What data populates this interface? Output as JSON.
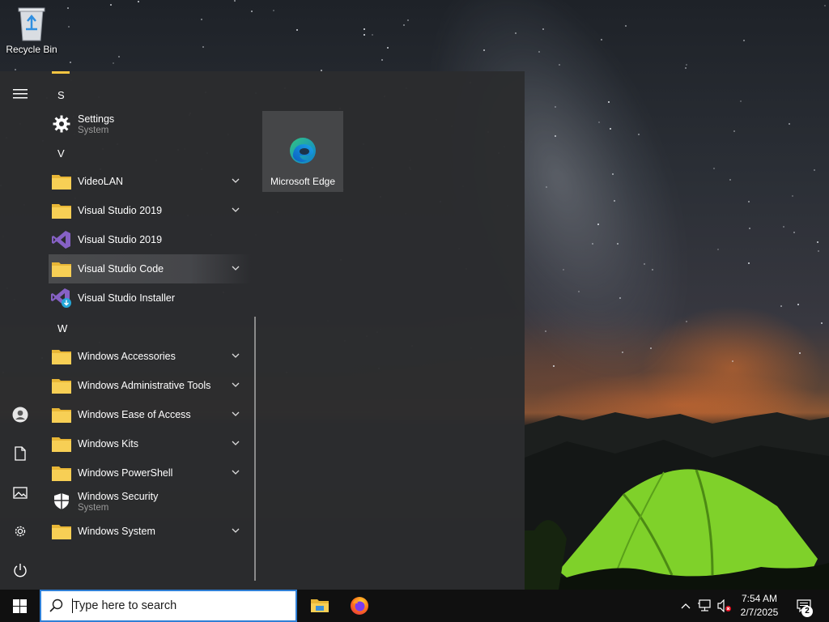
{
  "desktop": {
    "recycle_bin_label": "Recycle Bin"
  },
  "start_menu": {
    "rail_icons": [
      "hamburger-icon",
      "user-icon",
      "documents-icon",
      "pictures-icon",
      "settings-icon",
      "power-icon"
    ],
    "groups": {
      "s": "S",
      "v": "V",
      "w": "W"
    },
    "apps": [
      {
        "name": "Settings",
        "sub": "System",
        "icon": "gear-icon"
      },
      {
        "name": "VideoLAN",
        "icon": "folder-icon",
        "expandable": true
      },
      {
        "name": "Visual Studio 2019",
        "icon": "folder-icon",
        "expandable": true
      },
      {
        "name": "Visual Studio 2019",
        "icon": "visual-studio-icon"
      },
      {
        "name": "Visual Studio Code",
        "icon": "folder-icon",
        "expandable": true,
        "hovered": true
      },
      {
        "name": "Visual Studio Installer",
        "icon": "visual-studio-installer-icon"
      },
      {
        "name": "Windows Accessories",
        "icon": "folder-icon",
        "expandable": true
      },
      {
        "name": "Windows Administrative Tools",
        "icon": "folder-icon",
        "expandable": true
      },
      {
        "name": "Windows Ease of Access",
        "icon": "folder-icon",
        "expandable": true
      },
      {
        "name": "Windows Kits",
        "icon": "folder-icon",
        "expandable": true
      },
      {
        "name": "Windows PowerShell",
        "icon": "folder-icon",
        "expandable": true
      },
      {
        "name": "Windows Security",
        "sub": "System",
        "icon": "shield-icon"
      },
      {
        "name": "Windows System",
        "icon": "folder-icon",
        "expandable": true
      }
    ],
    "tiles": [
      {
        "label": "Microsoft Edge",
        "icon": "edge-icon"
      }
    ]
  },
  "taskbar": {
    "search_placeholder": "Type here to search",
    "pinned": [
      "file-explorer-icon",
      "firefox-icon"
    ],
    "tray_icons": [
      "chevron-up-icon",
      "network-icon",
      "volume-muted-icon"
    ],
    "time": "7:54 AM",
    "date": "2/7/2025",
    "notification_count": "2"
  },
  "colors": {
    "start_bg": "#2b2c2e",
    "taskbar_bg": "#101010",
    "search_border": "#2f7fd6",
    "folder_yellow": "#f5c542",
    "vs_purple": "#8661c5"
  }
}
